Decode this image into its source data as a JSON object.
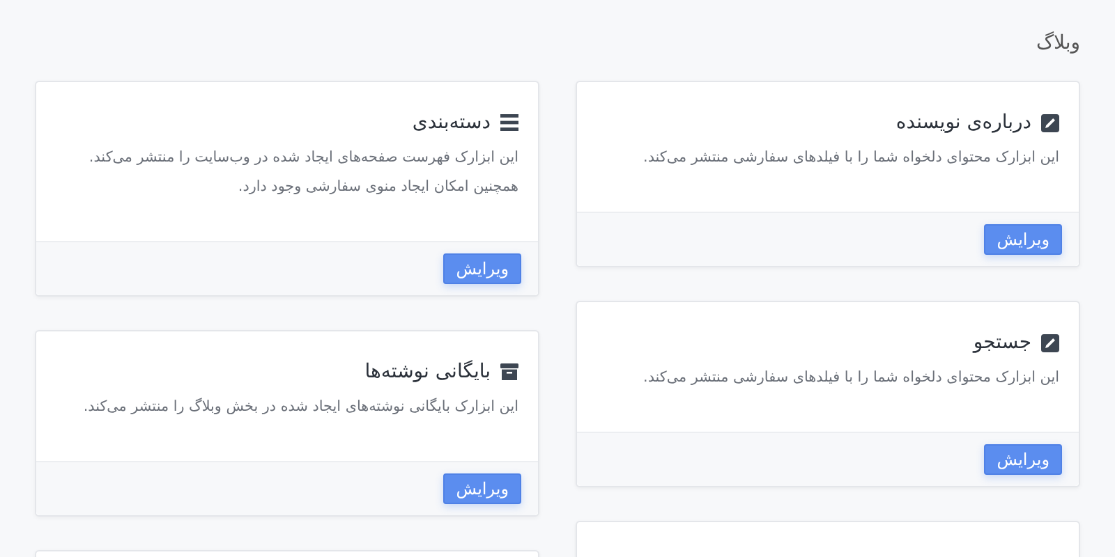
{
  "page_title": "وبلاگ",
  "columns": [
    {
      "cards": [
        {
          "kind": "edit",
          "title": "درباره‌ی نویسنده",
          "description": "این ابزارک محتوای دلخواه شما را با فیلدهای سفارشی منتشر می‌کند.",
          "button": "ویرایش"
        },
        {
          "kind": "edit",
          "title": "جستجو",
          "description": "این ابزارک محتوای دلخواه شما را با فیلدهای سفارشی منتشر می‌کند.",
          "button": "ویرایش"
        },
        {
          "kind": "blank"
        }
      ]
    },
    {
      "cards": [
        {
          "kind": "list",
          "title": "دسته‌بندی",
          "description": "این ابزارک فهرست صفحه‌های ایجاد شده در وب‌سایت را منتشر می‌کند. همچنین امکان ایجاد منوی سفارشی وجود دارد.",
          "button": "ویرایش"
        },
        {
          "kind": "archive",
          "title": "بایگانی نوشته‌ها",
          "description": "این ابزارک بایگانی نوشته‌های ایجاد شده در بخش وبلاگ را منتشر می‌کند.",
          "button": "ویرایش"
        },
        {
          "kind": "blank"
        }
      ]
    }
  ]
}
